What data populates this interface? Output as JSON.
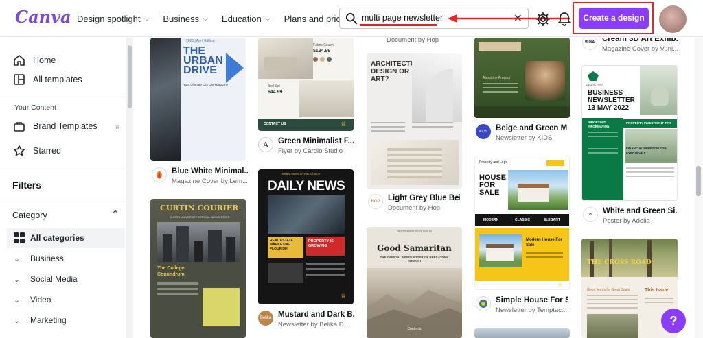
{
  "header": {
    "logo": "Canva",
    "nav": [
      {
        "label": "Design spotlight"
      },
      {
        "label": "Business"
      },
      {
        "label": "Education"
      },
      {
        "label": "Plans and pricing"
      }
    ],
    "search_value": "multi page newsletter",
    "create_label": "Create a design"
  },
  "sidebar": {
    "home": "Home",
    "all_templates": "All templates",
    "your_content": "Your Content",
    "brand_templates": "Brand Templates",
    "starred": "Starred",
    "filters": "Filters",
    "category": "Category",
    "categories": [
      "All categories",
      "Business",
      "Social Media",
      "Video",
      "Marketing"
    ]
  },
  "templates": {
    "c1": {
      "a": {
        "title": "Blue White Minimal...",
        "sub": "Magazine Cover by Lem...",
        "l1": "THE",
        "l2": "URBAN",
        "l3": "DRIVE",
        "tag": "2023 | April Edition",
        "small": "Your Ultimate City Car Magazine"
      },
      "b": {
        "title": "CURTIN COURIER",
        "sub2": "The College Conundrum",
        "tag": "CURTIN UNIVERSITY OFFICIAL NEWSLETTER"
      }
    },
    "c2": {
      "a": {
        "title": "Green Minimalist F...",
        "sub": "Flyer by Cardio Studio",
        "price1": "$124.99",
        "price2": "$44.99",
        "l1": "Fabric Couch",
        "l2": "Bed Set",
        "contact": "CONTACT US"
      },
      "b": {
        "title": "Mustard and Dark B...",
        "sub": "Newsletter by Belika D...",
        "head": "DAILY NEWS",
        "tag": "Trusted News of Your Choice",
        "l1": "REAL ESTATE MARKETING FLOURISH",
        "l2": "PROPERTY IS GROWING",
        "dot": "Belika"
      }
    },
    "c3": {
      "a": {
        "sub_top": "Document by Hop"
      },
      "b": {
        "title": "Light Grey Blue Bei...",
        "sub": "Document by Hop",
        "l1": "ARCHITECTURE,",
        "l2": "DESIGN OR",
        "l3": "ART?",
        "dot": "HOP"
      },
      "c": {
        "title": "Good Samaritan",
        "tag": "THE OFFICIAL NEWSLETTER OF BEECATONK CHURCH",
        "tag0": "DECEMBER 2022 ISSUE",
        "foot": "Contents"
      }
    },
    "c4": {
      "a": {
        "title": "Beige and Green M...",
        "sub": "Newsletter by KIDS",
        "l1": "About the Product",
        "dot": "KIDS"
      },
      "b": {
        "title": "Simple House For S...",
        "sub": "Newsletter by Temptac...",
        "l1": "HOUSE",
        "l2": "FOR",
        "l3": "SALE",
        "l4": "Modern House For Sale",
        "logo": "Property and Logo",
        "tags": [
          "MODERN",
          "CLASSIC",
          "ELEGANT"
        ]
      }
    },
    "c5": {
      "a": {
        "title": "Cream 3D Art Exhib...",
        "sub": "Magazine Cover by Vuni..."
      },
      "b": {
        "title": "White and Green Si...",
        "sub": "Poster by Adelia",
        "l1": "BUSINESS",
        "l2": "NEWSLETTER",
        "date": "13 MAY 2022",
        "news": "NEWS LOGO",
        "l3": "IMPORTANT INFORMATION",
        "l4": "PROPERTY INVESTMENT TIPS",
        "l5": "FINANCIAL FREEDOM FOR EVERYBODY"
      },
      "c": {
        "l1": "THE CROSS ROAD",
        "l2": "This Issue:",
        "l3": "Good words for Great Souls"
      }
    }
  },
  "help_label": "?"
}
